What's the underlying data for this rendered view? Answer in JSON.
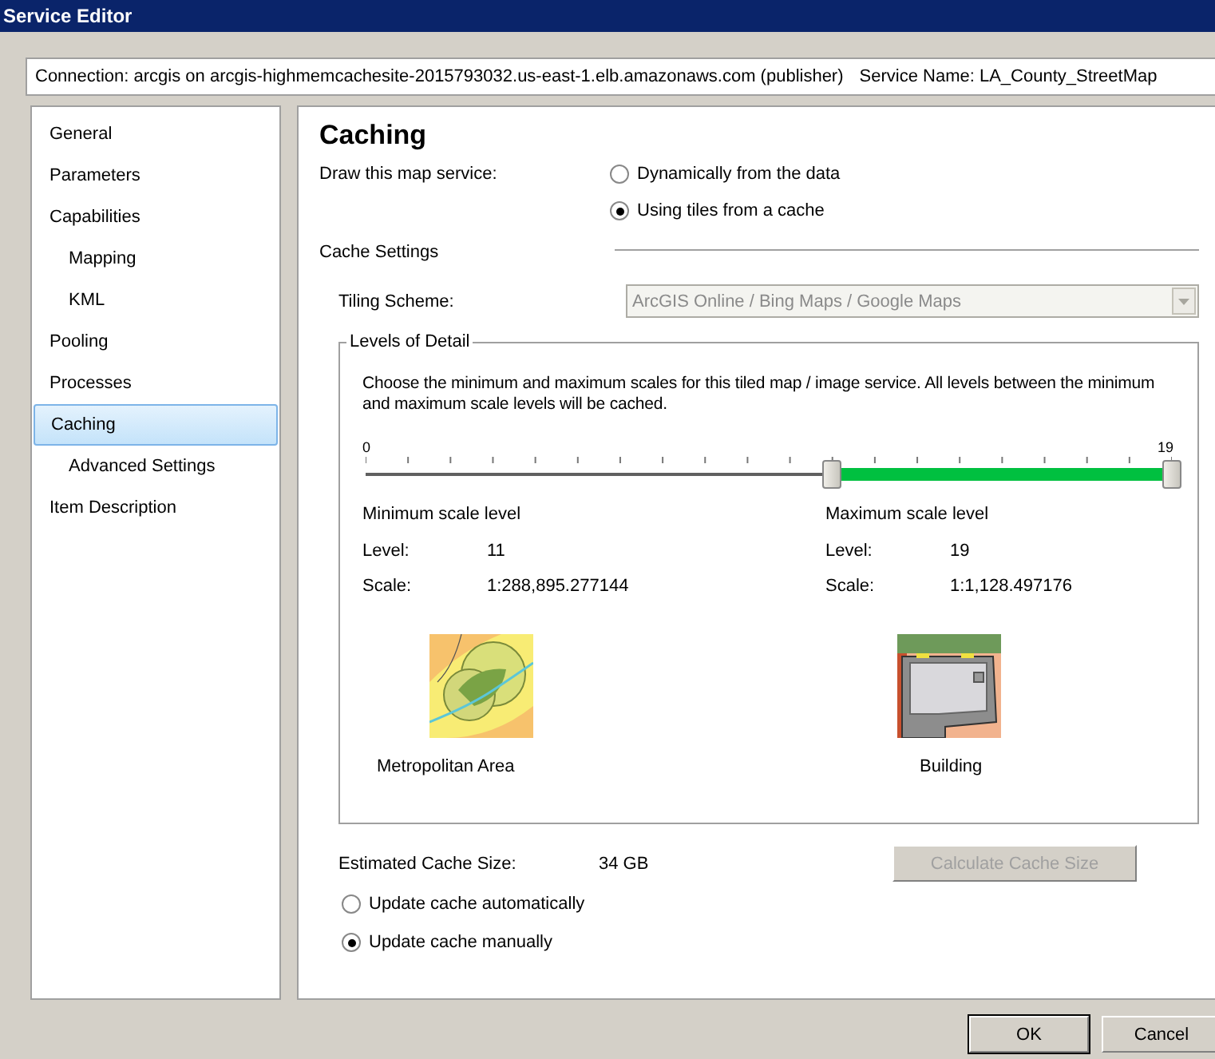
{
  "window": {
    "title": "Service Editor"
  },
  "connection": {
    "text": "Connection: arcgis on arcgis-highmemcachesite-2015793032.us-east-1.elb.amazonaws.com (publisher)",
    "service_name": "Service Name: LA_County_StreetMap"
  },
  "sidebar": {
    "items": [
      {
        "label": "General",
        "selected": false
      },
      {
        "label": "Parameters",
        "selected": false
      },
      {
        "label": "Capabilities",
        "selected": false,
        "children": [
          {
            "label": "Mapping",
            "selected": false
          },
          {
            "label": "KML",
            "selected": false
          }
        ]
      },
      {
        "label": "Pooling",
        "selected": false
      },
      {
        "label": "Processes",
        "selected": false
      },
      {
        "label": "Caching",
        "selected": true,
        "children": [
          {
            "label": "Advanced Settings",
            "selected": false
          }
        ]
      },
      {
        "label": "Item Description",
        "selected": false
      }
    ]
  },
  "page": {
    "title": "Caching",
    "draw_label": "Draw this map service:",
    "draw_options": [
      {
        "label": "Dynamically from the data",
        "selected": false
      },
      {
        "label": "Using tiles from a cache",
        "selected": true
      }
    ],
    "cache_settings": "Cache Settings",
    "tiling_scheme": {
      "label": "Tiling Scheme:",
      "value": "ArcGIS Online / Bing Maps / Google Maps",
      "disabled": true
    },
    "levels_of_detail": {
      "title": "Levels of Detail",
      "description": "Choose the minimum and maximum scales for this tiled map / image service. All levels between the minimum and maximum scale levels will be cached.",
      "min_label": "0",
      "max_label": "19",
      "thumbs": [
        {
          "level": 0.579
        },
        {
          "level": 1
        }
      ],
      "ends": [
        {
          "kind": "metro",
          "heading": "Minimum scale level",
          "level_label": "Level:",
          "level_value": "11",
          "scale_label": "Scale:",
          "scale_value": "1:288,895.277144",
          "caption": "Metropolitan Area"
        },
        {
          "kind": "building",
          "heading": "Maximum scale level",
          "level_label": "Level:",
          "level_value": "19",
          "scale_label": "Scale:",
          "scale_value": "1:1,128.497176",
          "caption": "Building"
        }
      ]
    },
    "estimated": {
      "label": "Estimated Cache Size:",
      "value": "34 GB"
    },
    "calculate_button": {
      "label": "Calculate Cache Size",
      "disabled": true
    },
    "update_options": [
      {
        "label": "Update cache automatically",
        "selected": false
      },
      {
        "label": "Update cache manually",
        "selected": true
      }
    ]
  },
  "buttons": [
    "OK",
    "Cancel"
  ]
}
